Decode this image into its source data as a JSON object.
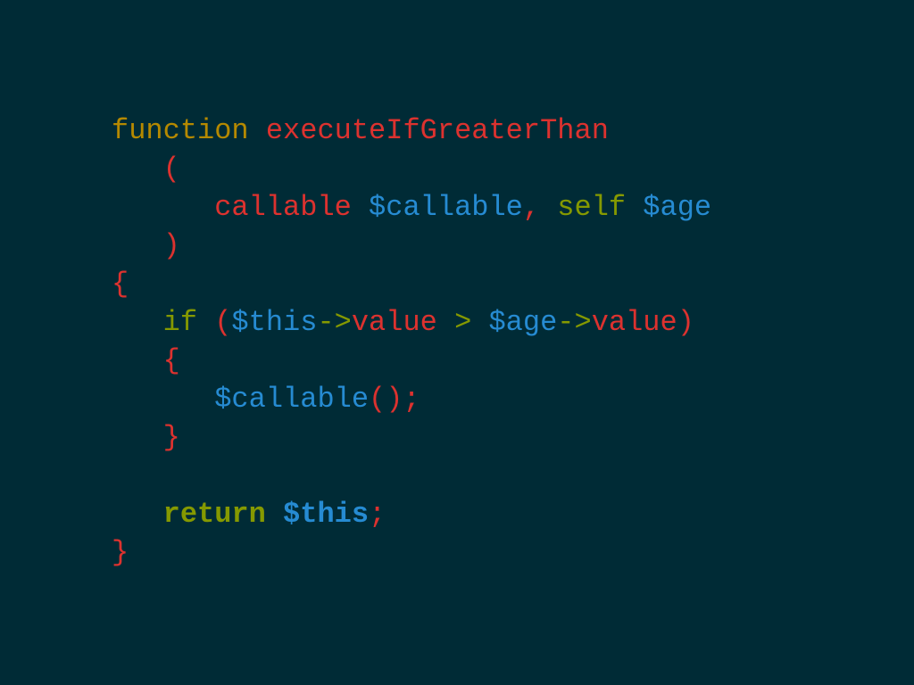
{
  "colors": {
    "background": "#002b36",
    "keyword_yellow": "#b58900",
    "red": "#dc322f",
    "green": "#859900",
    "blue": "#268bd2"
  },
  "code": {
    "lines": [
      [
        {
          "text": "function",
          "color": "#b58900"
        },
        {
          "text": " ",
          "color": "#b58900"
        },
        {
          "text": "executeIfGreaterThan",
          "color": "#dc322f"
        }
      ],
      [
        {
          "text": "   ",
          "color": "#dc322f"
        },
        {
          "text": "(",
          "color": "#dc322f"
        }
      ],
      [
        {
          "text": "      ",
          "color": "#dc322f"
        },
        {
          "text": "callable",
          "color": "#dc322f"
        },
        {
          "text": " ",
          "color": "#dc322f"
        },
        {
          "text": "$callable",
          "color": "#268bd2"
        },
        {
          "text": ",",
          "color": "#dc322f"
        },
        {
          "text": " ",
          "color": "#dc322f"
        },
        {
          "text": "self",
          "color": "#859900"
        },
        {
          "text": " ",
          "color": "#859900"
        },
        {
          "text": "$age",
          "color": "#268bd2"
        }
      ],
      [
        {
          "text": "   ",
          "color": "#dc322f"
        },
        {
          "text": ")",
          "color": "#dc322f"
        }
      ],
      [
        {
          "text": "{",
          "color": "#dc322f"
        }
      ],
      [
        {
          "text": "   ",
          "color": "#859900"
        },
        {
          "text": "if",
          "color": "#859900"
        },
        {
          "text": " ",
          "color": "#859900"
        },
        {
          "text": "(",
          "color": "#dc322f"
        },
        {
          "text": "$this",
          "color": "#268bd2"
        },
        {
          "text": "->",
          "color": "#859900"
        },
        {
          "text": "value",
          "color": "#dc322f"
        },
        {
          "text": " ",
          "color": "#859900"
        },
        {
          "text": ">",
          "color": "#859900"
        },
        {
          "text": " ",
          "color": "#859900"
        },
        {
          "text": "$age",
          "color": "#268bd2"
        },
        {
          "text": "->",
          "color": "#859900"
        },
        {
          "text": "value",
          "color": "#dc322f"
        },
        {
          "text": ")",
          "color": "#dc322f"
        }
      ],
      [
        {
          "text": "   ",
          "color": "#dc322f"
        },
        {
          "text": "{",
          "color": "#dc322f"
        }
      ],
      [
        {
          "text": "      ",
          "color": "#268bd2"
        },
        {
          "text": "$callable",
          "color": "#268bd2"
        },
        {
          "text": "();",
          "color": "#dc322f"
        }
      ],
      [
        {
          "text": "   ",
          "color": "#dc322f"
        },
        {
          "text": "}",
          "color": "#dc322f"
        }
      ],
      [],
      [
        {
          "text": "   ",
          "color": "#859900"
        },
        {
          "text": "return",
          "color": "#859900",
          "bold": true
        },
        {
          "text": " ",
          "color": "#859900"
        },
        {
          "text": "$this",
          "color": "#268bd2",
          "bold": true
        },
        {
          "text": ";",
          "color": "#dc322f"
        }
      ],
      [
        {
          "text": "}",
          "color": "#dc322f"
        }
      ]
    ]
  }
}
